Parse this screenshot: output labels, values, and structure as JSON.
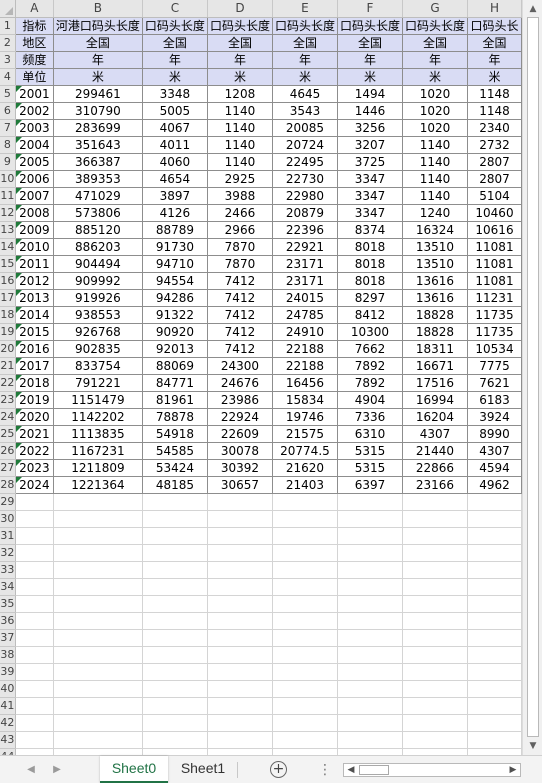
{
  "columns": [
    "A",
    "B",
    "C",
    "D",
    "E",
    "F",
    "G",
    "H"
  ],
  "header_rows": [
    [
      "指标",
      "河港口码头长度",
      "口码头长度",
      "口码头长度",
      "口码头长度",
      "口码头长度",
      "口码头长度",
      "口码头长"
    ],
    [
      "地区",
      "全国",
      "全国",
      "全国",
      "全国",
      "全国",
      "全国",
      "全国"
    ],
    [
      "频度",
      "年",
      "年",
      "年",
      "年",
      "年",
      "年",
      "年"
    ],
    [
      "单位",
      "米",
      "米",
      "米",
      "米",
      "米",
      "米",
      "米"
    ]
  ],
  "data_rows": [
    [
      "2001",
      "299461",
      "3348",
      "1208",
      "4645",
      "1494",
      "1020",
      "1148"
    ],
    [
      "2002",
      "310790",
      "5005",
      "1140",
      "3543",
      "1446",
      "1020",
      "1148"
    ],
    [
      "2003",
      "283699",
      "4067",
      "1140",
      "20085",
      "3256",
      "1020",
      "2340"
    ],
    [
      "2004",
      "351643",
      "4011",
      "1140",
      "20724",
      "3207",
      "1140",
      "2732"
    ],
    [
      "2005",
      "366387",
      "4060",
      "1140",
      "22495",
      "3725",
      "1140",
      "2807"
    ],
    [
      "2006",
      "389353",
      "4654",
      "2925",
      "22730",
      "3347",
      "1140",
      "2807"
    ],
    [
      "2007",
      "471029",
      "3897",
      "3988",
      "22980",
      "3347",
      "1140",
      "5104"
    ],
    [
      "2008",
      "573806",
      "4126",
      "2466",
      "20879",
      "3347",
      "1240",
      "10460"
    ],
    [
      "2009",
      "885120",
      "88789",
      "2966",
      "22396",
      "8374",
      "16324",
      "10616"
    ],
    [
      "2010",
      "886203",
      "91730",
      "7870",
      "22921",
      "8018",
      "13510",
      "11081"
    ],
    [
      "2011",
      "904494",
      "94710",
      "7870",
      "23171",
      "8018",
      "13510",
      "11081"
    ],
    [
      "2012",
      "909992",
      "94554",
      "7412",
      "23171",
      "8018",
      "13616",
      "11081"
    ],
    [
      "2013",
      "919926",
      "94286",
      "7412",
      "24015",
      "8297",
      "13616",
      "11231"
    ],
    [
      "2014",
      "938553",
      "91322",
      "7412",
      "24785",
      "8412",
      "18828",
      "11735"
    ],
    [
      "2015",
      "926768",
      "90920",
      "7412",
      "24910",
      "10300",
      "18828",
      "11735"
    ],
    [
      "2016",
      "902835",
      "92013",
      "7412",
      "22188",
      "7662",
      "18311",
      "10534"
    ],
    [
      "2017",
      "833754",
      "88069",
      "24300",
      "22188",
      "7892",
      "16671",
      "7775"
    ],
    [
      "2018",
      "791221",
      "84771",
      "24676",
      "16456",
      "7892",
      "17516",
      "7621"
    ],
    [
      "2019",
      "1151479",
      "81961",
      "23986",
      "15834",
      "4904",
      "16994",
      "6183"
    ],
    [
      "2020",
      "1142202",
      "78878",
      "22924",
      "19746",
      "7336",
      "16204",
      "3924"
    ],
    [
      "2021",
      "1113835",
      "54918",
      "22609",
      "21575",
      "6310",
      "4307",
      "8990"
    ],
    [
      "2022",
      "1167231",
      "54585",
      "30078",
      "20774.5",
      "5315",
      "21440",
      "4307"
    ],
    [
      "2023",
      "1211809",
      "53424",
      "30392",
      "21620",
      "5315",
      "22866",
      "4594"
    ],
    [
      "2024",
      "1221364",
      "48185",
      "30657",
      "21403",
      "6397",
      "23166",
      "4962"
    ]
  ],
  "row_numbers": [
    "1",
    "2",
    "3",
    "4",
    "5",
    "6",
    "7",
    "8",
    "9",
    "10",
    "11",
    "12",
    "13",
    "14",
    "15",
    "16",
    "17",
    "18",
    "19",
    "20",
    "21",
    "22",
    "23",
    "24",
    "25",
    "26",
    "27",
    "28",
    "29",
    "30",
    "31",
    "32",
    "33",
    "34",
    "35",
    "36",
    "37",
    "38",
    "39",
    "40",
    "41",
    "42",
    "43",
    "44"
  ],
  "sheet_tabs": [
    "Sheet0",
    "Sheet1"
  ],
  "active_sheet": "Sheet0",
  "icons": {
    "add_sheet": "plus-circle-icon",
    "nav_prev": "triangle-left-icon",
    "nav_next": "triangle-right-icon",
    "more": "ellipsis-icon"
  },
  "colors": {
    "header_fill": "#d9dcf4",
    "accent": "#217346",
    "error_indicator": "#1f7a3a"
  }
}
